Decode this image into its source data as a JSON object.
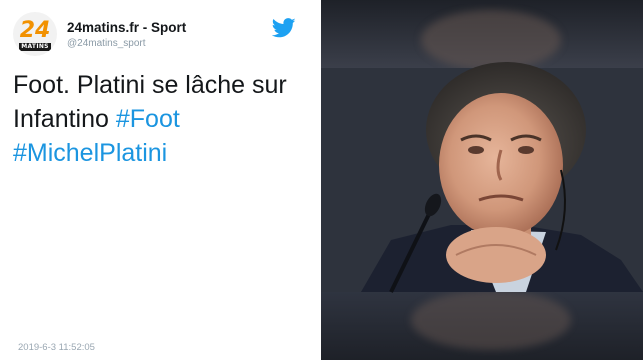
{
  "account": {
    "avatar_number": "24",
    "avatar_word": "MATINS",
    "name": "24matins.fr - Sport",
    "handle": "@24matins_sport"
  },
  "tweet": {
    "text_plain": "Foot. Platini se lâche sur Infantino",
    "hashtags": [
      "#Foot",
      "#MichelPlatini"
    ]
  },
  "timestamp": "2019-6-3 11:52:05",
  "icons": {
    "brand": "twitter-bird-icon",
    "photo": "press-conference-photo"
  },
  "colors": {
    "hashtag": "#1b95e0",
    "twitter_blue": "#1da1f2",
    "avatar_orange": "#f29100"
  }
}
